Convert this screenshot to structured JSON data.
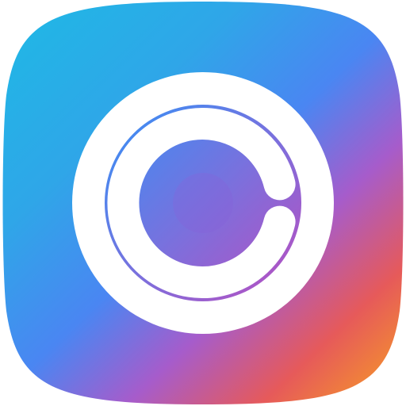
{
  "app_icon": {
    "icon_name": "camera-lens-app-icon",
    "colors": {
      "background": "#ffffff",
      "gradient_start": "#22B5E6",
      "gradient_mid_blue": "#4A86F2",
      "gradient_mid_purple": "#A65CCB",
      "gradient_red": "#E65A5A",
      "gradient_end": "#F5962A",
      "ring": "#ffffff"
    }
  }
}
